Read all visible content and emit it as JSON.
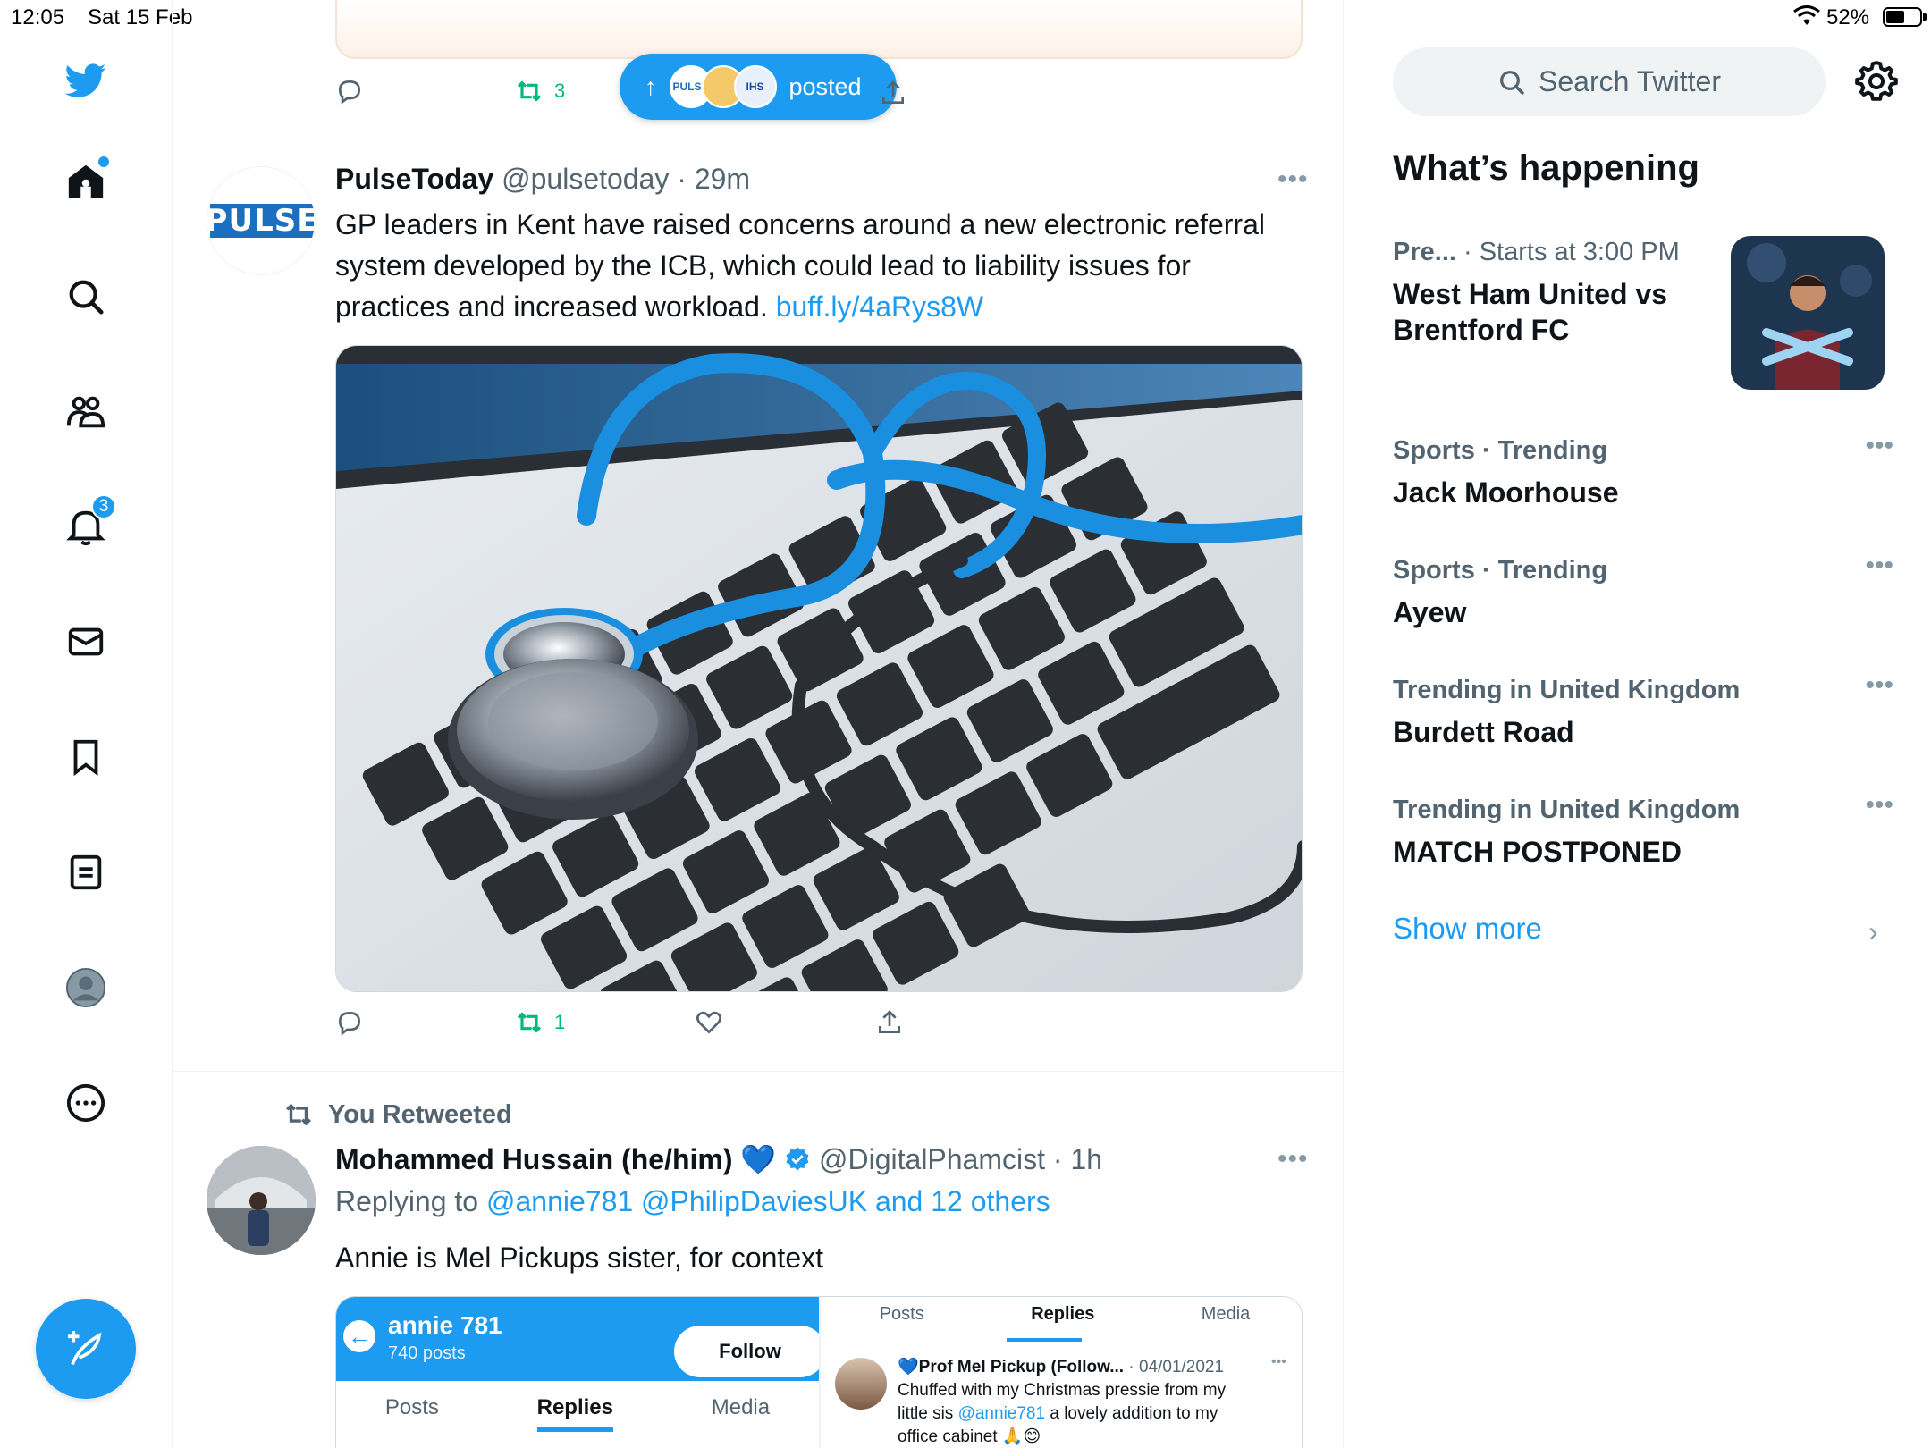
{
  "status_bar": {
    "time": "12:05",
    "date": "Sat 15 Feb",
    "battery": "52%"
  },
  "nav": {
    "notifications_badge": "3",
    "items": [
      "home-icon",
      "search-icon",
      "communities-icon",
      "notifications-icon",
      "messages-icon",
      "bookmarks-icon",
      "lists-icon",
      "profile-icon",
      "more-icon"
    ]
  },
  "prev_tweet": {
    "retweets": "3"
  },
  "posted_pill": {
    "label": "posted",
    "avatar_1": "PULSE",
    "avatar_3": "IHS"
  },
  "tweet1": {
    "name": "PulseToday",
    "handle": "@pulsetoday",
    "time": "29m",
    "avatar_text": "PULSE",
    "text": "GP leaders in Kent have raised concerns around a new electronic referral system developed by the ICB, which could lead to liability issues for practices and increased workload.",
    "link": "buff.ly/4aRys8W",
    "retweets": "1"
  },
  "tweet2": {
    "retweet_label": "You Retweeted",
    "name": "Mohammed Hussain (he/him)",
    "heart_emoji": "💙",
    "handle": "@DigitalPhamcist",
    "time": "1h",
    "replying_prefix": "Replying to",
    "replying_links": "@annie781 @PhilipDaviesUK and 12 others",
    "text": "Annie is Mel Pickups sister, for context",
    "embed": {
      "profile_name": "annie 781",
      "profile_posts": "740 posts",
      "follow_label": "Follow",
      "tabs_left": [
        "Posts",
        "Replies",
        "Media"
      ],
      "tabs_right": [
        "Posts",
        "Replies",
        "Media"
      ],
      "quoted_name": "💙Prof Mel Pickup (Follow...",
      "quoted_date": "· 04/01/2021",
      "quoted_line1": "Chuffed with my Christmas pressie from my",
      "quoted_line2_pre": "little sis",
      "quoted_mention": "@annie781",
      "quoted_line2_post": "a lovely addition to my",
      "quoted_line3": "office cabinet 🙏😊"
    }
  },
  "right": {
    "search_placeholder": "Search Twitter",
    "whats_happening": "What’s happening",
    "event": {
      "category": "Pre...",
      "time": "· Starts at 3:00 PM",
      "title": "West Ham United vs Brentford FC"
    },
    "trends": [
      {
        "meta": "Sports · Trending",
        "title": "Jack Moorhouse"
      },
      {
        "meta": "Sports · Trending",
        "title": "Ayew"
      },
      {
        "meta": "Trending in United Kingdom",
        "title": "Burdett Road"
      },
      {
        "meta": "Trending in United Kingdom",
        "title": "MATCH POSTPONED"
      }
    ],
    "show_more": "Show more"
  },
  "colors": {
    "accent": "#1d9bf0",
    "retweet": "#00ba7c",
    "secondary_text": "#536471"
  }
}
